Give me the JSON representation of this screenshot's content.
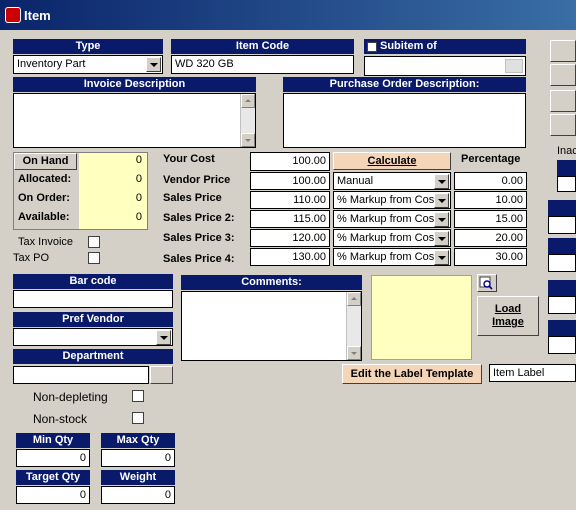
{
  "window": {
    "title": "Item"
  },
  "type": {
    "header": "Type",
    "value": "Inventory Part"
  },
  "item_code": {
    "header": "Item Code",
    "value": "WD 320 GB"
  },
  "subitem": {
    "header": "Subitem of",
    "value": ""
  },
  "invoice_description": {
    "header": "Invoice Description",
    "value": ""
  },
  "po_description": {
    "header": "Purchase Order Description:",
    "value": ""
  },
  "stock": {
    "on_hand_label": "On Hand",
    "on_hand": "0",
    "allocated_label": "Allocated:",
    "allocated": "0",
    "on_order_label": "On Order:",
    "on_order": "0",
    "available_label": "Available:",
    "available": "0"
  },
  "tax": {
    "tax_invoice_label": "Tax Invoice",
    "tax_po_label": "Tax PO"
  },
  "pricing": {
    "your_cost_label": "Your Cost",
    "your_cost": "100.00",
    "calculate_label": "Calculate",
    "percentage_label": "Percentage",
    "vendor_price_label": "Vendor Price",
    "vendor_price": "100.00",
    "vendor_method": "Manual",
    "vendor_pct": "0.00",
    "rows": [
      {
        "label": "Sales Price",
        "value": "110.00",
        "method": "% Markup from Cost",
        "pct": "10.00"
      },
      {
        "label": "Sales Price 2:",
        "value": "115.00",
        "method": "% Markup from Cost",
        "pct": "15.00"
      },
      {
        "label": "Sales Price 3:",
        "value": "120.00",
        "method": "% Markup from Cost",
        "pct": "20.00"
      },
      {
        "label": "Sales Price 4:",
        "value": "130.00",
        "method": "% Markup from Cost",
        "pct": "30.00"
      }
    ]
  },
  "barcode": {
    "header": "Bar code",
    "value": ""
  },
  "comments": {
    "header": "Comments:",
    "value": ""
  },
  "image": {
    "load_label": "Load Image"
  },
  "pref_vendor": {
    "header": "Pref Vendor",
    "value": ""
  },
  "department": {
    "header": "Department",
    "value": ""
  },
  "flags": {
    "non_depleting_label": "Non-depleting",
    "non_stock_label": "Non-stock"
  },
  "label_template": {
    "button_label": "Edit the Label Template",
    "value": "Item Label"
  },
  "qty": {
    "min_label": "Min Qty",
    "min": "0",
    "max_label": "Max Qty",
    "max": "0",
    "target_label": "Target Qty",
    "target": "0",
    "weight_label": "Weight",
    "weight": "0"
  },
  "side": {
    "inactive_label": "Inac"
  },
  "colors": {
    "header_navy": "#0a1a6a",
    "yellow_panel": "#ffffc0",
    "window_bg": "#d4d0c8",
    "titlebar": "#0a246a"
  }
}
